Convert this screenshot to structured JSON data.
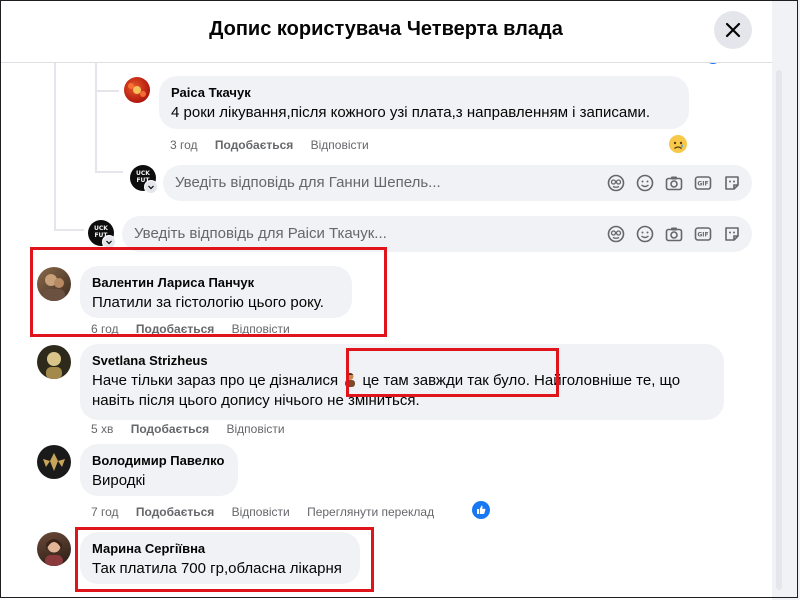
{
  "dialog": {
    "title": "Допис користувача Четверта влада"
  },
  "thread": {
    "reply_to_raisa": {
      "author": "Раіса Ткачук",
      "text": "4 роки лікування,після кожного узі плата,з направленням і записами.",
      "time": "3 год",
      "like": "Подобається",
      "reply": "Відповісти",
      "reaction": "sad"
    },
    "reply_input_hanna": {
      "placeholder": "Уведіть відповідь для Ганни Шепель..."
    },
    "reply_input_raisa": {
      "placeholder": "Уведіть відповідь для Раіси Ткачук..."
    },
    "avatar_badge_text": "UCK FUT"
  },
  "comments": [
    {
      "author": "Валентин Лариса Панчук",
      "text": "Платили за гістологію цього року.",
      "time": "6 год",
      "like": "Подобається",
      "reply": "Відповісти"
    },
    {
      "author": "Svetlana Strizheus",
      "text_line1_a": "Наче тільки зараз про це дізналися",
      "text_line1_b": "це там завжди так було. Найголовніше те, що",
      "text_line2": "навіть після цього допису нічього не зміниться.",
      "time": "5 хв",
      "like": "Подобається",
      "reply": "Відповісти"
    },
    {
      "author": "Володимир Павелко",
      "text": "Виродкі",
      "time": "7 год",
      "like": "Подобається",
      "reply": "Відповісти",
      "translate": "Переглянути переклад",
      "reaction": "like"
    },
    {
      "author": "Марина Сергіївна",
      "text": "Так платила 700 гр,обласна лікарня"
    }
  ],
  "icons": {
    "input": [
      "avatar-sticker-icon",
      "emoji-icon",
      "camera-icon",
      "gif-icon",
      "sticker-icon"
    ],
    "close": "close-icon"
  },
  "colors": {
    "highlight": "#e0151b",
    "bubble": "#f0f2f5",
    "meta_text": "#65676b",
    "like_blue": "#1877f2"
  }
}
